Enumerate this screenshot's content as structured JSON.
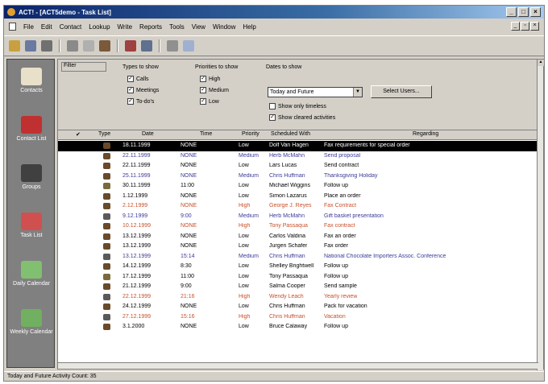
{
  "window": {
    "title": "ACT! - [ACT5demo - Task List]"
  },
  "menubar": [
    "File",
    "Edit",
    "Contact",
    "Lookup",
    "Write",
    "Reports",
    "Tools",
    "View",
    "Window",
    "Help"
  ],
  "filter": {
    "tab_label": "Filter",
    "types_title": "Types to show",
    "types": [
      {
        "label": "Calls",
        "checked": true
      },
      {
        "label": "Meetings",
        "checked": true
      },
      {
        "label": "To-do's",
        "checked": true
      }
    ],
    "priorities_title": "Priorities to show",
    "priorities": [
      {
        "label": "High",
        "checked": true
      },
      {
        "label": "Medium",
        "checked": true
      },
      {
        "label": "Low",
        "checked": true
      }
    ],
    "dates_title": "Dates to show",
    "dates_value": "Today and Future",
    "show_timeless": {
      "label": "Show only timeless",
      "checked": false
    },
    "show_cleared": {
      "label": "Show cleared activities",
      "checked": true
    },
    "select_users_label": "Select Users..."
  },
  "viewbar": [
    {
      "label": "Contacts",
      "icon": "contacts-icon"
    },
    {
      "label": "Contact List",
      "icon": "contact-list-icon"
    },
    {
      "label": "Groups",
      "icon": "groups-icon"
    },
    {
      "label": "Task List",
      "icon": "task-list-icon"
    },
    {
      "label": "Daily Calendar",
      "icon": "daily-calendar-icon"
    },
    {
      "label": "Weekly Calendar",
      "icon": "weekly-calendar-icon"
    }
  ],
  "grid": {
    "columns": [
      "Type",
      "Date",
      "Time",
      "Priority",
      "Scheduled With",
      "Regarding"
    ],
    "rows": [
      {
        "type": "call",
        "date": "18.11.1999",
        "time": "NONE",
        "priority": "Low",
        "with": "Dolf Van Hagen",
        "regarding": "Fax requirements for special order",
        "color": "#ffffff",
        "selected": true
      },
      {
        "type": "call",
        "date": "22.11.1999",
        "time": "NONE",
        "priority": "Medium",
        "with": "Herb McMahn",
        "regarding": "Send proposal",
        "color": "#3a3a9a",
        "selected": false
      },
      {
        "type": "call",
        "date": "22.11.1999",
        "time": "NONE",
        "priority": "Low",
        "with": "Lars Lucas",
        "regarding": "Send contract",
        "color": "#000000",
        "selected": false
      },
      {
        "type": "call",
        "date": "25.11.1999",
        "time": "NONE",
        "priority": "Medium",
        "with": "Chris Huffman",
        "regarding": "Thanksgiving Holiday",
        "color": "#3a3a9a",
        "selected": false
      },
      {
        "type": "todo",
        "date": "30.11.1999",
        "time": "11:00",
        "priority": "Low",
        "with": "Michael Wiggins",
        "regarding": "Follow up",
        "color": "#000000",
        "selected": false
      },
      {
        "type": "call",
        "date": "1.12.1999",
        "time": "NONE",
        "priority": "Low",
        "with": "Simon Lazarus",
        "regarding": "Place an order",
        "color": "#000000",
        "selected": false
      },
      {
        "type": "call",
        "date": "2.12.1999",
        "time": "NONE",
        "priority": "High",
        "with": "George J. Reyes",
        "regarding": "Fax Contract",
        "color": "#c8502a",
        "selected": false
      },
      {
        "type": "meeting",
        "date": "9.12.1999",
        "time": "9:00",
        "priority": "Medium",
        "with": "Herb McMahn",
        "regarding": "Gift basket presentation",
        "color": "#3a3a9a",
        "selected": false
      },
      {
        "type": "call",
        "date": "10.12.1999",
        "time": "NONE",
        "priority": "High",
        "with": "Tony Passaqua",
        "regarding": "Fax contract",
        "color": "#c8502a",
        "selected": false
      },
      {
        "type": "call",
        "date": "13.12.1999",
        "time": "NONE",
        "priority": "Low",
        "with": "Carlos Valdina",
        "regarding": "Fax an order",
        "color": "#000000",
        "selected": false
      },
      {
        "type": "call",
        "date": "13.12.1999",
        "time": "NONE",
        "priority": "Low",
        "with": "Jurgen Schafer",
        "regarding": "Fax order",
        "color": "#000000",
        "selected": false
      },
      {
        "type": "meeting",
        "date": "13.12.1999",
        "time": "15:14",
        "priority": "Medium",
        "with": "Chris Huffman",
        "regarding": "National Chocolate Importers Assoc. Conference",
        "color": "#3a3a9a",
        "selected": false
      },
      {
        "type": "call",
        "date": "14.12.1999",
        "time": "8:30",
        "priority": "Low",
        "with": "Shelley Brightwell",
        "regarding": "Follow up",
        "color": "#000000",
        "selected": false
      },
      {
        "type": "todo",
        "date": "17.12.1999",
        "time": "11:00",
        "priority": "Low",
        "with": "Tony Passaqua",
        "regarding": "Follow up",
        "color": "#000000",
        "selected": false
      },
      {
        "type": "call",
        "date": "21.12.1999",
        "time": "9:00",
        "priority": "Low",
        "with": "Salma Cooper",
        "regarding": "Send sample",
        "color": "#000000",
        "selected": false
      },
      {
        "type": "meeting",
        "date": "22.12.1999",
        "time": "21:16",
        "priority": "High",
        "with": "Wendy Leach",
        "regarding": "Yearly review",
        "color": "#c8502a",
        "selected": false
      },
      {
        "type": "call",
        "date": "24.12.1999",
        "time": "NONE",
        "priority": "Low",
        "with": "Chris Huffman",
        "regarding": "Pack for vacation",
        "color": "#000000",
        "selected": false
      },
      {
        "type": "meeting",
        "date": "27.12.1999",
        "time": "15:16",
        "priority": "High",
        "with": "Chris Huffman",
        "regarding": "Vacation",
        "color": "#c8502a",
        "selected": false
      },
      {
        "type": "call",
        "date": "3.1.2000",
        "time": "NONE",
        "priority": "Low",
        "with": "Bruce Calaway",
        "regarding": "Follow up",
        "color": "#000000",
        "selected": false
      }
    ]
  },
  "status": "Today and Future   Activity Count: 35"
}
